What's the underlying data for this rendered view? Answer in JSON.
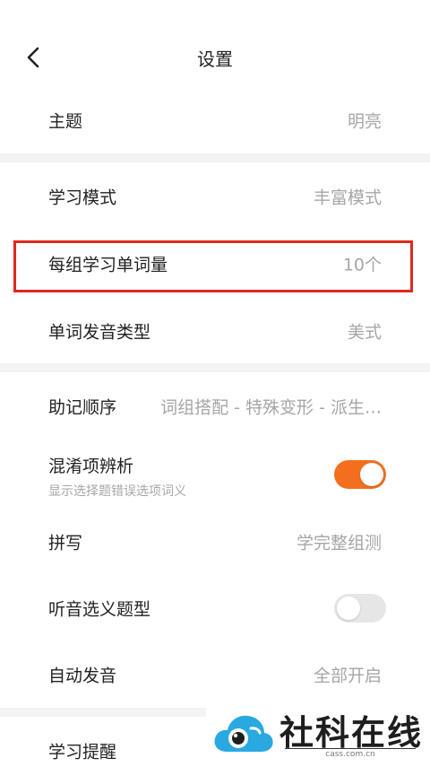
{
  "header": {
    "title": "设置",
    "back_icon": "chevron-left-icon"
  },
  "settings": {
    "theme": {
      "label": "主题",
      "value": "明亮"
    },
    "study_mode": {
      "label": "学习模式",
      "value": "丰富模式"
    },
    "words_per_group": {
      "label": "每组学习单词量",
      "value": "10个"
    },
    "pronunciation": {
      "label": "单词发音类型",
      "value": "美式"
    },
    "mnemonic_order": {
      "label": "助记顺序",
      "value": "词组搭配 - 特殊变形 - 派生…"
    },
    "confusion_analysis": {
      "label": "混淆项辨析",
      "description": "显示选择题错误选项词义",
      "enabled": true
    },
    "spelling": {
      "label": "拼写",
      "value": "学完整组测"
    },
    "listening_question": {
      "label": "听音选义题型",
      "enabled": false
    },
    "auto_pronounce": {
      "label": "自动发音",
      "value": "全部开启"
    },
    "study_reminder": {
      "label": "学习提醒"
    }
  },
  "colors": {
    "accent": "#f36f1e",
    "highlight_border": "#e0281e",
    "value_text": "#a6a6a6",
    "divider": "#f3f3f3"
  },
  "watermark": {
    "text": "社科在线",
    "url": "cass.com.cn"
  }
}
